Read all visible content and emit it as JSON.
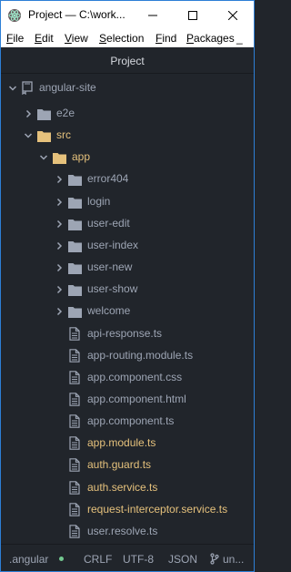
{
  "window": {
    "title": "Project — C:\\work...",
    "controls": [
      "minimize",
      "maximize",
      "close"
    ]
  },
  "menu": {
    "items": [
      {
        "accel": "F",
        "rest": "ile"
      },
      {
        "accel": "E",
        "rest": "dit"
      },
      {
        "accel": "V",
        "rest": "iew"
      },
      {
        "accel": "S",
        "rest": "election"
      },
      {
        "accel": "F",
        "rest": "ind"
      },
      {
        "accel": "P",
        "rest": "ackages"
      }
    ],
    "overflow": "_"
  },
  "panel": {
    "title": "Project"
  },
  "tree": {
    "root": "angular-site",
    "items": [
      {
        "label": "e2e",
        "type": "folder",
        "state": "collapsed",
        "depth": 1
      },
      {
        "label": "src",
        "type": "folder",
        "state": "expanded",
        "depth": 1
      },
      {
        "label": "app",
        "type": "folder",
        "state": "expanded",
        "depth": 2
      },
      {
        "label": "error404",
        "type": "folder",
        "state": "collapsed",
        "depth": 3
      },
      {
        "label": "login",
        "type": "folder",
        "state": "collapsed",
        "depth": 3
      },
      {
        "label": "user-edit",
        "type": "folder",
        "state": "collapsed",
        "depth": 3
      },
      {
        "label": "user-index",
        "type": "folder",
        "state": "collapsed",
        "depth": 3
      },
      {
        "label": "user-new",
        "type": "folder",
        "state": "collapsed",
        "depth": 3
      },
      {
        "label": "user-show",
        "type": "folder",
        "state": "collapsed",
        "depth": 3
      },
      {
        "label": "welcome",
        "type": "folder",
        "state": "collapsed",
        "depth": 3
      },
      {
        "label": "api-response.ts",
        "type": "file",
        "modified": false,
        "depth": 3
      },
      {
        "label": "app-routing.module.ts",
        "type": "file",
        "modified": false,
        "depth": 3
      },
      {
        "label": "app.component.css",
        "type": "file",
        "modified": false,
        "depth": 3
      },
      {
        "label": "app.component.html",
        "type": "file",
        "modified": false,
        "depth": 3
      },
      {
        "label": "app.component.ts",
        "type": "file",
        "modified": false,
        "depth": 3
      },
      {
        "label": "app.module.ts",
        "type": "file",
        "modified": true,
        "depth": 3
      },
      {
        "label": "auth.guard.ts",
        "type": "file",
        "modified": true,
        "depth": 3
      },
      {
        "label": "auth.service.ts",
        "type": "file",
        "modified": true,
        "depth": 3
      },
      {
        "label": "request-interceptor.service.ts",
        "type": "file",
        "modified": true,
        "depth": 3
      },
      {
        "label": "user.resolve.ts",
        "type": "file",
        "modified": false,
        "depth": 3
      }
    ]
  },
  "status": {
    "file": ".angular",
    "line_ending": "CRLF",
    "encoding": "UTF-8",
    "grammar": "JSON",
    "branch": "un..."
  },
  "colors": {
    "background": "#21252b",
    "text": "#9da5b4",
    "modified": "#e5c17c",
    "accent_border": "#2d7fd6",
    "status_dot": "#73c990"
  }
}
